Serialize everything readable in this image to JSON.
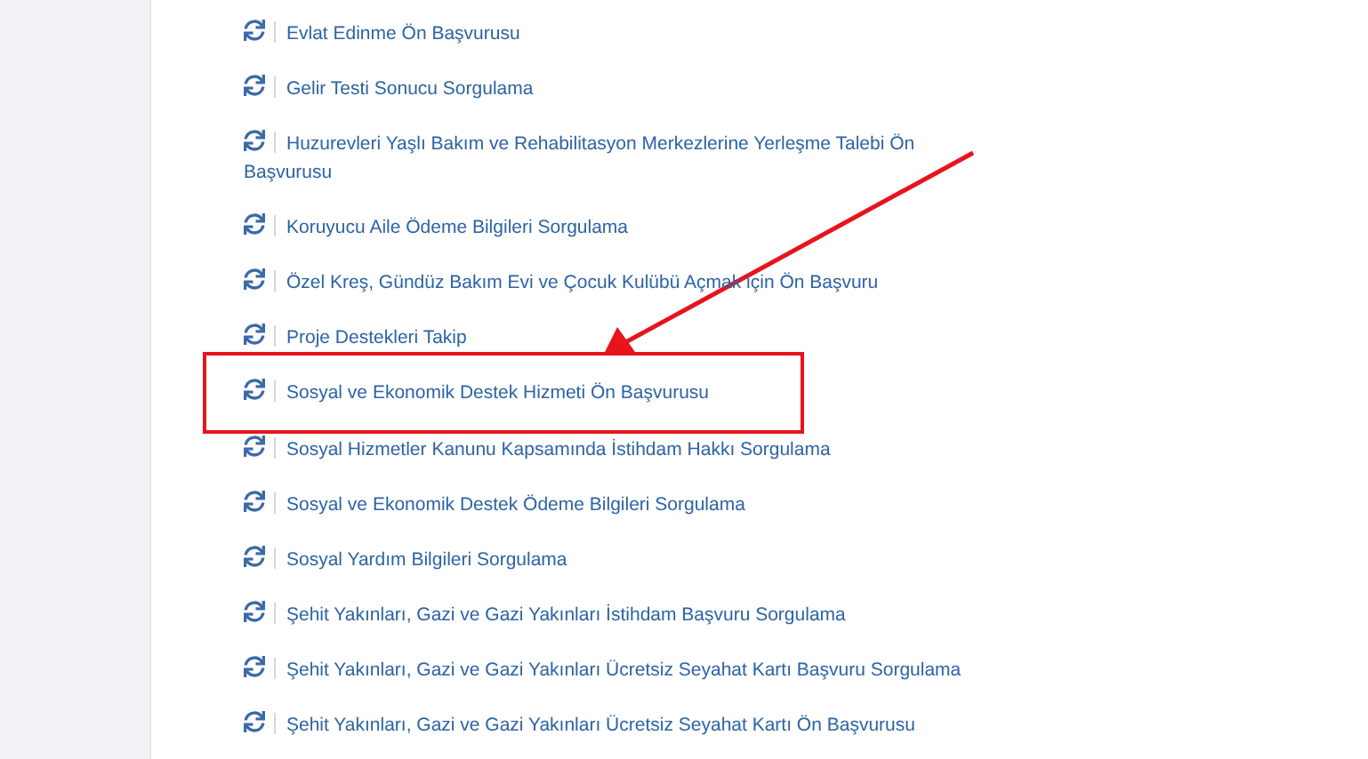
{
  "services": [
    {
      "label": "Evlat Edinme Ön Başvurusu",
      "highlighted": false
    },
    {
      "label": "Gelir Testi Sonucu Sorgulama",
      "highlighted": false
    },
    {
      "label": "Huzurevleri Yaşlı Bakım ve Rehabilitasyon Merkezlerine Yerleşme Talebi Ön Başvurusu",
      "highlighted": false
    },
    {
      "label": "Koruyucu Aile Ödeme Bilgileri Sorgulama",
      "highlighted": false
    },
    {
      "label": "Özel Kreş, Gündüz Bakım Evi ve Çocuk Kulübü Açmak için Ön Başvuru",
      "highlighted": false
    },
    {
      "label": "Proje Destekleri Takip",
      "highlighted": false
    },
    {
      "label": "Sosyal ve Ekonomik Destek Hizmeti Ön Başvurusu",
      "highlighted": true
    },
    {
      "label": "Sosyal Hizmetler Kanunu Kapsamında İstihdam Hakkı Sorgulama",
      "highlighted": false
    },
    {
      "label": "Sosyal ve Ekonomik Destek Ödeme Bilgileri Sorgulama",
      "highlighted": false
    },
    {
      "label": "Sosyal Yardım Bilgileri Sorgulama",
      "highlighted": false
    },
    {
      "label": "Şehit Yakınları, Gazi ve Gazi Yakınları İstihdam Başvuru Sorgulama",
      "highlighted": false
    },
    {
      "label": "Şehit Yakınları, Gazi ve Gazi Yakınları Ücretsiz Seyahat Kartı Başvuru Sorgulama",
      "highlighted": false
    },
    {
      "label": "Şehit Yakınları, Gazi ve Gazi Yakınları Ücretsiz Seyahat Kartı Ön Başvurusu",
      "highlighted": false
    }
  ]
}
